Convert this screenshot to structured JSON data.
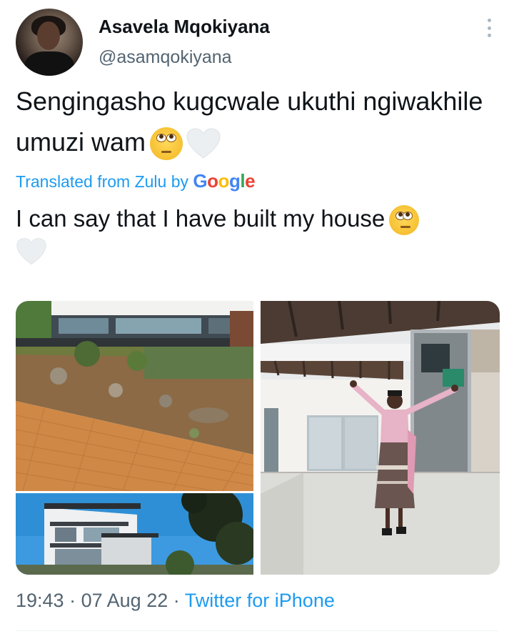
{
  "author": {
    "display_name": "Asavela Mqokiyana",
    "handle": "@asamqokiyana"
  },
  "tweet": {
    "text": "Sengingasho kugcwale ukuthi ngiwakhile umuzi wam",
    "emojis": [
      "face-with-rolling-eyes-emoji",
      "white-heart-emoji"
    ]
  },
  "translation": {
    "label": "Translated from Zulu by",
    "provider": "Google",
    "text": "I can say that I have built my house"
  },
  "media": {
    "photo_count": 3,
    "photos": [
      {
        "name": "house-garden-driveway-photo"
      },
      {
        "name": "house-exterior-balconies-photo"
      },
      {
        "name": "woman-celebrating-patio-photo"
      }
    ]
  },
  "meta": {
    "time": "19:43",
    "separator": "·",
    "date": "07 Aug 22",
    "source": "Twitter for iPhone"
  },
  "colors": {
    "link": "#1d9bf0",
    "secondary_text": "#536471",
    "primary_text": "#0f1419"
  },
  "icons": {
    "more": "more-vertical-icon"
  }
}
